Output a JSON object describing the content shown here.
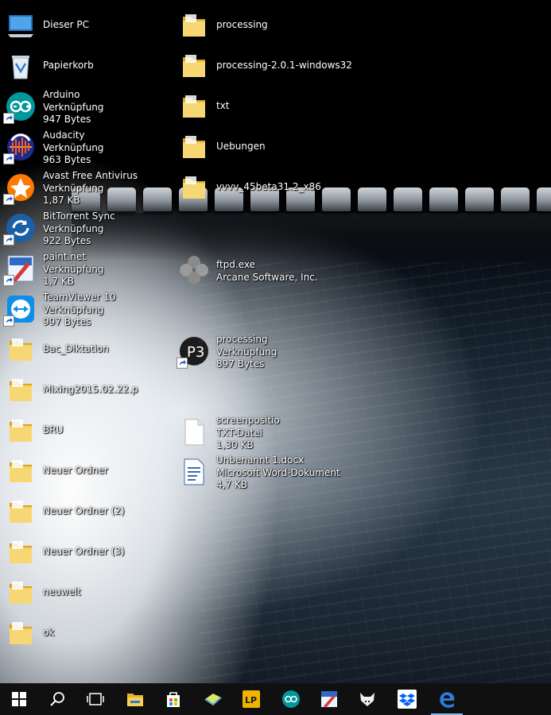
{
  "desktop": {
    "left_column": [
      {
        "name": "dieser-pc",
        "icon": "computer-icon",
        "lines": [
          "Dieser PC"
        ],
        "shortcut": false
      },
      {
        "name": "papierkorb",
        "icon": "recycle-bin-icon",
        "lines": [
          "Papierkorb"
        ],
        "shortcut": false
      },
      {
        "name": "arduino",
        "icon": "arduino-icon",
        "lines": [
          "Arduino",
          "Verknüpfung",
          "947 Bytes"
        ],
        "shortcut": true
      },
      {
        "name": "audacity",
        "icon": "audacity-icon",
        "lines": [
          "Audacity",
          "Verknüpfung",
          "963 Bytes"
        ],
        "shortcut": true
      },
      {
        "name": "avast",
        "icon": "avast-icon",
        "lines": [
          "Avast Free Antivirus",
          "Verknüpfung",
          "1,87 KB"
        ],
        "shortcut": true
      },
      {
        "name": "bittorrent-sync",
        "icon": "bittorrent-sync-icon",
        "lines": [
          "BitTorrent Sync",
          "Verknüpfung",
          "922 Bytes"
        ],
        "shortcut": true
      },
      {
        "name": "paint-net",
        "icon": "paint-net-icon",
        "lines": [
          "paint.net",
          "Verknüpfung",
          "1,7 KB"
        ],
        "shortcut": true
      },
      {
        "name": "teamviewer",
        "icon": "teamviewer-icon",
        "lines": [
          "TeamViewer 10",
          "Verknüpfung",
          "997 Bytes"
        ],
        "shortcut": true
      },
      {
        "name": "folder-1",
        "icon": "folder-icon",
        "lines": [
          "Bac_Diktation"
        ],
        "shortcut": false
      },
      {
        "name": "folder-2",
        "icon": "folder-icon",
        "lines": [
          "Mixing2015.02.22.p"
        ],
        "shortcut": false
      },
      {
        "name": "folder-3",
        "icon": "folder-icon",
        "lines": [
          "BRU"
        ],
        "shortcut": false
      },
      {
        "name": "folder-4",
        "icon": "folder-icon",
        "lines": [
          "Neuer Ordner"
        ],
        "shortcut": false
      },
      {
        "name": "folder-5",
        "icon": "folder-icon",
        "lines": [
          "Neuer Ordner (2)"
        ],
        "shortcut": false
      },
      {
        "name": "folder-6",
        "icon": "folder-icon",
        "lines": [
          "Neuer Ordner (3)"
        ],
        "shortcut": false
      },
      {
        "name": "folder-7",
        "icon": "folder-icon",
        "lines": [
          "neuwelt"
        ],
        "shortcut": false
      },
      {
        "name": "folder-8",
        "icon": "folder-icon",
        "lines": [
          "ok"
        ],
        "shortcut": false
      }
    ],
    "right_column": [
      {
        "name": "processing-folder",
        "icon": "folder-icon",
        "lines": [
          "processing"
        ],
        "shortcut": false
      },
      {
        "name": "processing-windows32-folder",
        "icon": "folder-icon",
        "lines": [
          "processing-2.0.1-windows32"
        ],
        "shortcut": false
      },
      {
        "name": "txt-folder",
        "icon": "folder-icon",
        "lines": [
          "txt"
        ],
        "shortcut": false
      },
      {
        "name": "uebungen-folder",
        "icon": "folder-icon",
        "lines": [
          "Uebungen"
        ],
        "shortcut": false
      },
      {
        "name": "vvvv-folder",
        "icon": "folder-icon",
        "lines": [
          "vvvv_45beta31.2_x86"
        ],
        "shortcut": false
      },
      {
        "name": "ftpd",
        "icon": "ftpd-icon",
        "lines": [
          "ftpd.exe",
          "Arcane Software, Inc."
        ],
        "shortcut": false
      },
      {
        "name": "processing-shortcut",
        "icon": "processing-icon",
        "lines": [
          "processing",
          "Verknüpfung",
          "897 Bytes"
        ],
        "shortcut": true
      },
      {
        "name": "text-file",
        "icon": "document-icon",
        "lines": [
          "screenpositio",
          "TXT-Datei",
          "1,30 KB"
        ],
        "shortcut": false
      },
      {
        "name": "word-document",
        "icon": "word-document-icon",
        "lines": [
          "Unbenannt 1.docx",
          "Microsoft Word-Dokument",
          "4,7 KB"
        ],
        "shortcut": false
      }
    ]
  },
  "taskbar": {
    "buttons": [
      {
        "name": "start-button",
        "icon": "windows-icon"
      },
      {
        "name": "search-button",
        "icon": "search-icon"
      },
      {
        "name": "task-view-button",
        "icon": "task-view-icon"
      },
      {
        "name": "file-explorer-button",
        "icon": "file-explorer-icon"
      },
      {
        "name": "store-button",
        "icon": "store-icon"
      },
      {
        "name": "sticky-app-button",
        "icon": "note-icon"
      },
      {
        "name": "lp-app-button",
        "icon": "lp-icon"
      },
      {
        "name": "arduino-button",
        "icon": "arduino-icon"
      },
      {
        "name": "paint-net-button",
        "icon": "paint-net-icon"
      },
      {
        "name": "fox-app-button",
        "icon": "fox-icon"
      },
      {
        "name": "dropbox-button",
        "icon": "dropbox-icon"
      },
      {
        "name": "edge-button",
        "icon": "edge-icon"
      }
    ],
    "lp_text": "LP"
  },
  "colors": {
    "taskbar_bg": "#101010",
    "folder_yellow": "#f2c94c",
    "accent_blue": "#2b7bd8"
  }
}
